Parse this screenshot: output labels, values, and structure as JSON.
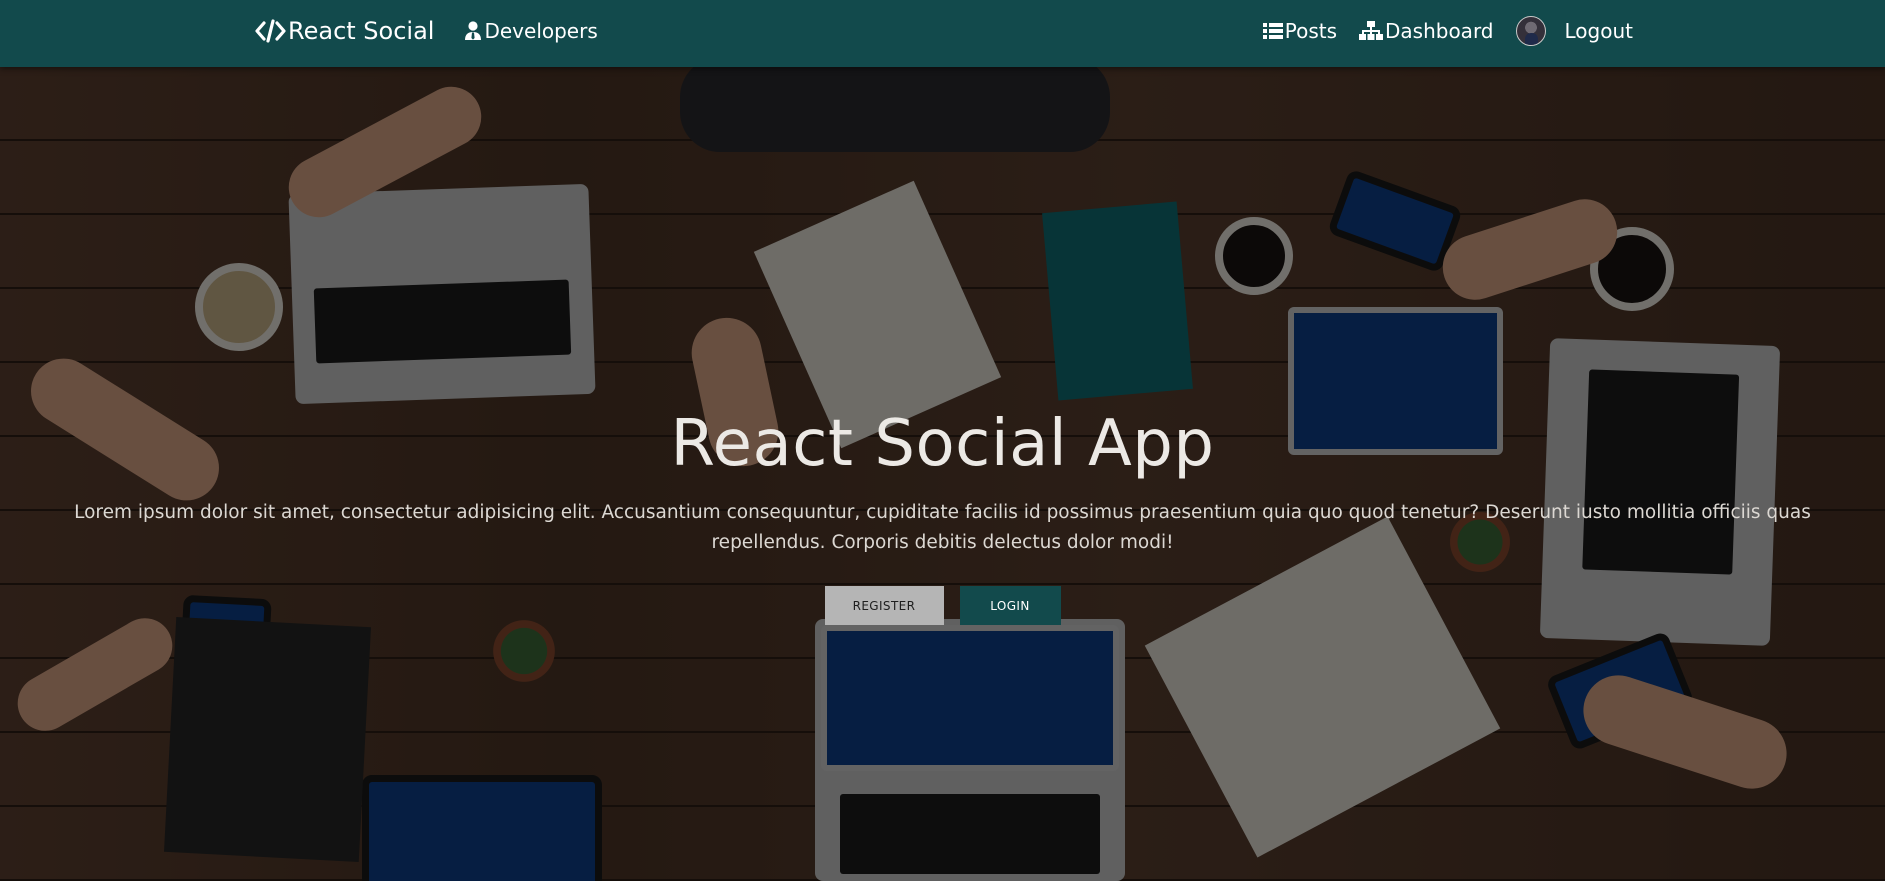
{
  "navbar": {
    "brand_label": "React Social",
    "developers_label": "Developers",
    "posts_label": "Posts",
    "dashboard_label": "Dashboard",
    "logout_label": "Logout"
  },
  "hero": {
    "title": "React Social App",
    "description": "Lorem ipsum dolor sit amet, consectetur adipisicing elit. Accusantium consequuntur, cupiditate facilis id possimus praesentium quia quo quod tenetur? Deserunt iusto mollitia officiis quas repellendus. Corporis debitis delectus dolor modi!",
    "register_label": "REGISTER",
    "login_label": "LOGIN"
  },
  "colors": {
    "navbar_bg": "#124a4c",
    "login_bg": "#124a4c",
    "register_bg": "#b5b5b5"
  },
  "icons": {
    "brand": "code-icon",
    "developers": "user-tie-icon",
    "posts": "list-icon",
    "dashboard": "sitemap-icon",
    "avatar": "user-avatar"
  }
}
